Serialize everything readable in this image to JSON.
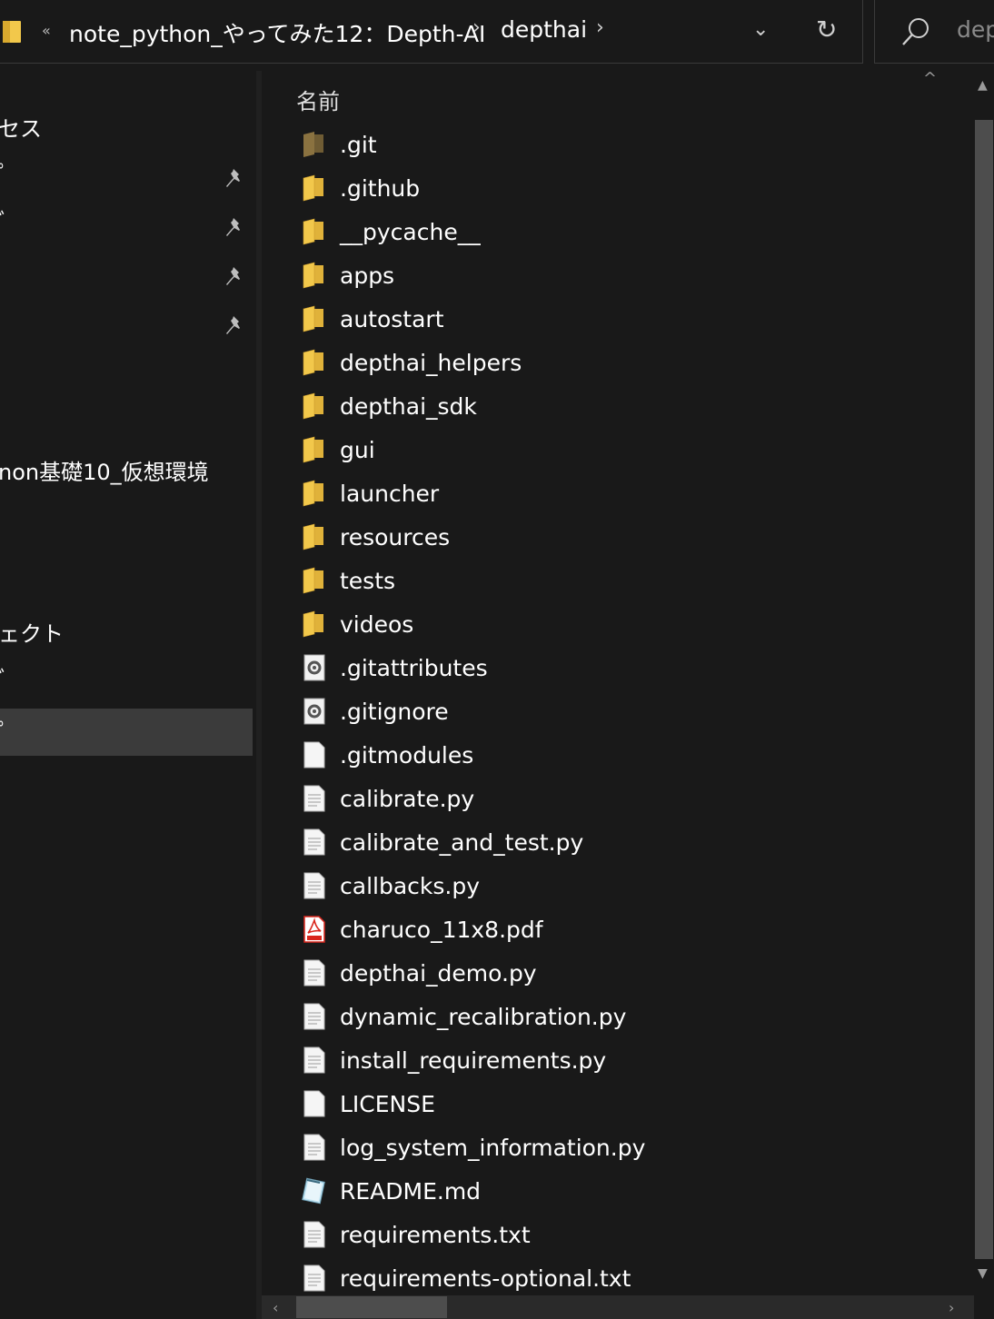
{
  "address_bar": {
    "overflow": "«",
    "crumbs": [
      "note_python_やってみた12：Depth-AI",
      "depthai"
    ],
    "separator": "›",
    "dropdown_glyph": "⌄",
    "refresh_glyph": "↻"
  },
  "search": {
    "placeholder": "dep"
  },
  "nav": {
    "items": [
      {
        "label": "セス",
        "pinned": false,
        "selected": false
      },
      {
        "label": "ﾟ",
        "pinned": true,
        "selected": false
      },
      {
        "label": "ﾞ",
        "pinned": true,
        "selected": false
      },
      {
        "label": "",
        "pinned": true,
        "selected": false
      },
      {
        "label": "",
        "pinned": true,
        "selected": false
      },
      {
        "label": "non基礎10_仮想環境",
        "pinned": false,
        "selected": false
      },
      {
        "label": "ェクト",
        "pinned": false,
        "selected": false
      },
      {
        "label": "ﾞ",
        "pinned": false,
        "selected": false
      },
      {
        "label": "ﾟ",
        "pinned": false,
        "selected": true
      }
    ]
  },
  "content": {
    "column_header": "名前",
    "sort_glyph": "^",
    "files": [
      {
        "name": ".git",
        "icon": "folder-hidden-icon"
      },
      {
        "name": ".github",
        "icon": "folder-icon"
      },
      {
        "name": "__pycache__",
        "icon": "folder-icon"
      },
      {
        "name": "apps",
        "icon": "folder-icon"
      },
      {
        "name": "autostart",
        "icon": "folder-icon"
      },
      {
        "name": "depthai_helpers",
        "icon": "folder-icon"
      },
      {
        "name": "depthai_sdk",
        "icon": "folder-icon"
      },
      {
        "name": "gui",
        "icon": "folder-icon"
      },
      {
        "name": "launcher",
        "icon": "folder-icon"
      },
      {
        "name": "resources",
        "icon": "folder-icon"
      },
      {
        "name": "tests",
        "icon": "folder-icon"
      },
      {
        "name": "videos",
        "icon": "folder-icon"
      },
      {
        "name": ".gitattributes",
        "icon": "settings-file-icon"
      },
      {
        "name": ".gitignore",
        "icon": "settings-file-icon"
      },
      {
        "name": ".gitmodules",
        "icon": "blank-file-icon"
      },
      {
        "name": "calibrate.py",
        "icon": "text-file-icon"
      },
      {
        "name": "calibrate_and_test.py",
        "icon": "text-file-icon"
      },
      {
        "name": "callbacks.py",
        "icon": "text-file-icon"
      },
      {
        "name": "charuco_11x8.pdf",
        "icon": "pdf-file-icon"
      },
      {
        "name": "depthai_demo.py",
        "icon": "text-file-icon"
      },
      {
        "name": "dynamic_recalibration.py",
        "icon": "text-file-icon"
      },
      {
        "name": "install_requirements.py",
        "icon": "text-file-icon"
      },
      {
        "name": "LICENSE",
        "icon": "blank-file-icon"
      },
      {
        "name": "log_system_information.py",
        "icon": "text-file-icon"
      },
      {
        "name": "README.md",
        "icon": "notepad-file-icon"
      },
      {
        "name": "requirements.txt",
        "icon": "text-file-icon"
      },
      {
        "name": "requirements-optional.txt",
        "icon": "text-file-icon"
      }
    ]
  },
  "colors": {
    "background": "#191919",
    "folder": "#f2c84b",
    "selected": "#3b3b3b",
    "pdf": "#d9261c"
  }
}
